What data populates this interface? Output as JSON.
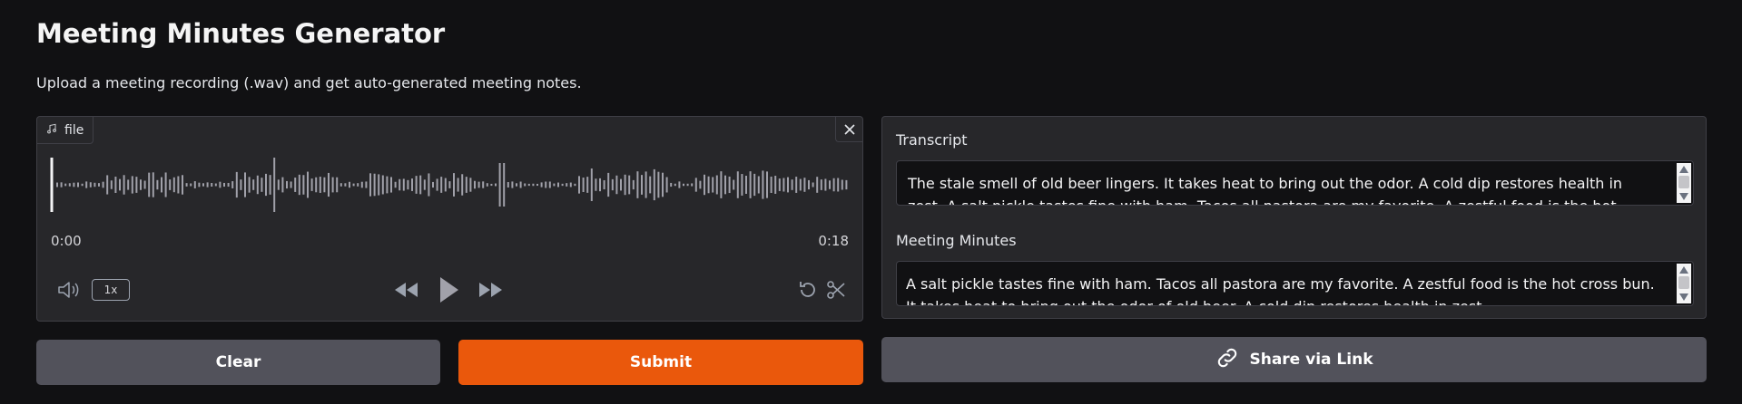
{
  "app": {
    "title": "Meeting Minutes Generator",
    "description": "Upload a meeting recording (.wav) and get auto-generated meeting notes."
  },
  "audio": {
    "file_label": "file",
    "icons": {
      "file": "music-note-icon",
      "close": "close-icon"
    },
    "time_start": "0:00",
    "time_end": "0:18",
    "playback_speed": "1x",
    "controls": [
      "volume-icon",
      "rewind-icon",
      "play-icon",
      "fast-forward-icon",
      "undo-icon",
      "scissors-icon"
    ]
  },
  "transcript": {
    "label": "Transcript",
    "value": " The stale smell of old beer lingers. It takes heat to bring out the odor. A cold dip restores health in zest. A salt pickle tastes fine with ham. Tacos all pastora are my favorite. A zestful food is the hot cross bun."
  },
  "minutes": {
    "label": "Meeting Minutes",
    "value": "A salt pickle tastes fine with ham. Tacos all pastora are my favorite. A zestful food is the hot cross bun. It takes heat to bring out the odor of old beer. A cold dip restores health in zest."
  },
  "buttons": {
    "clear": "Clear",
    "submit": "Submit",
    "share": "Share via Link",
    "share_icon": "link-icon"
  },
  "colors": {
    "background": "#111113",
    "panel": "#27272a",
    "primary": "#ea580c",
    "secondary": "#52525b"
  }
}
